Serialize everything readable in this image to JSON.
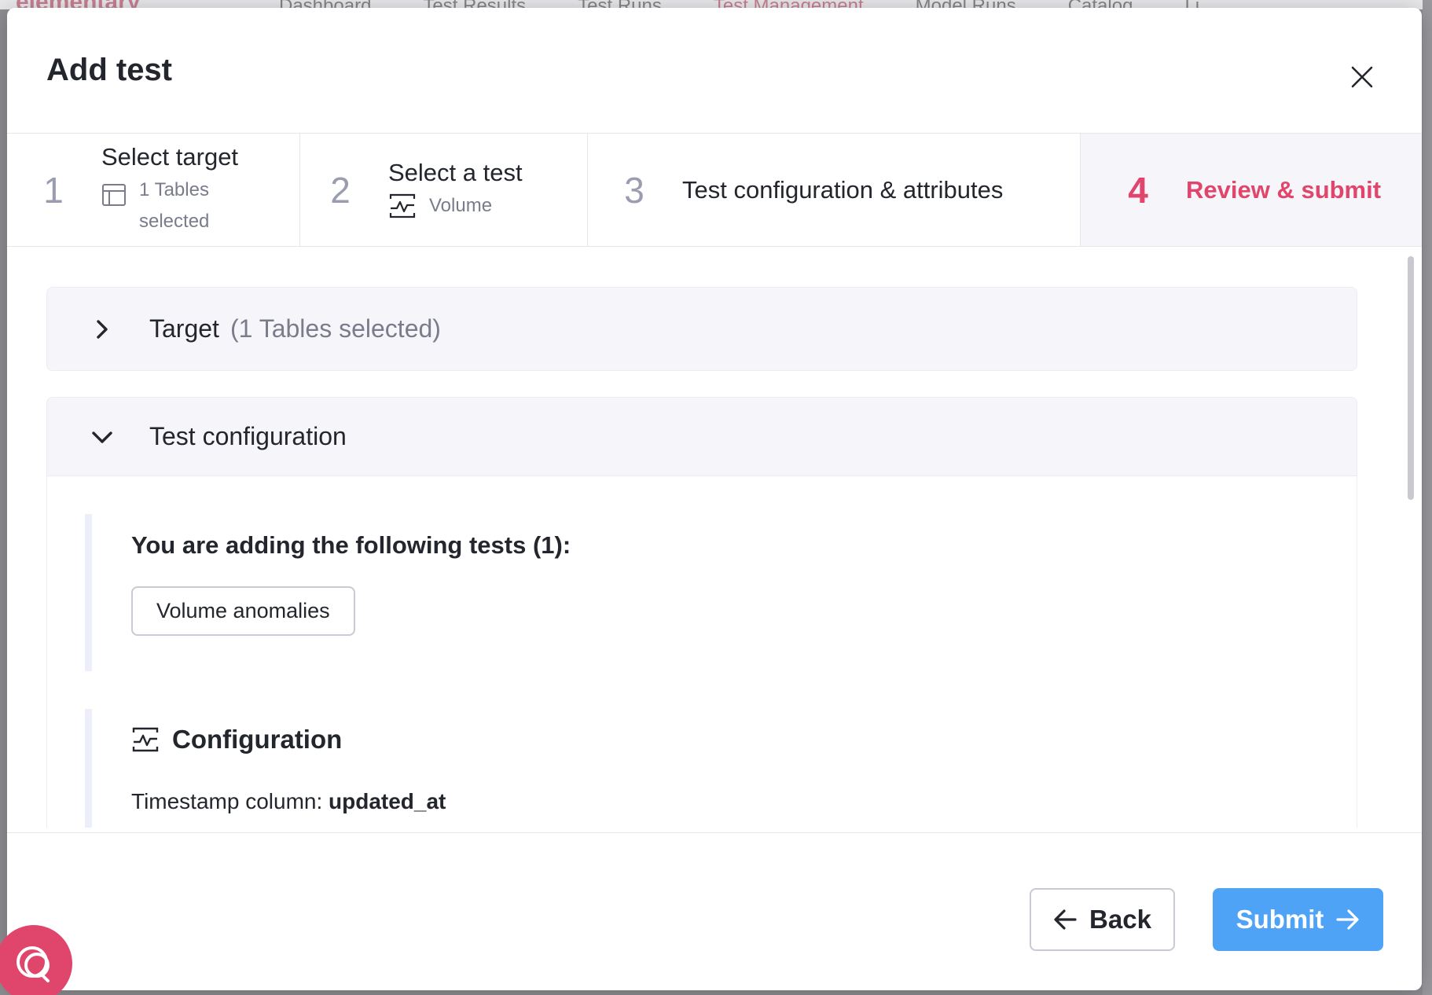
{
  "background": {
    "logo": "elementary",
    "nav_tabs": [
      "Dashboard",
      "Test Results",
      "Test Runs",
      "Test Management",
      "Model Runs",
      "Catalog",
      "Li"
    ],
    "active_tab": "Test Management"
  },
  "modal": {
    "title": "Add test",
    "close_icon": "close-icon"
  },
  "stepper": {
    "steps": [
      {
        "number": "1",
        "label": "Select target",
        "sub": "1 Tables selected",
        "icon": "table-icon"
      },
      {
        "number": "2",
        "label": "Select a test",
        "sub": "Volume",
        "icon": "volume-chart-icon"
      },
      {
        "number": "3",
        "label": "Test configuration & attributes"
      },
      {
        "number": "4",
        "label": "Review & submit",
        "active": true
      }
    ]
  },
  "sections": {
    "target": {
      "title": "Target",
      "count": "(1 Tables selected)",
      "expanded": false
    },
    "test_configuration": {
      "title": "Test configuration",
      "expanded": true,
      "adding_title": "You are adding the following tests (1):",
      "tests": [
        "Volume anomalies"
      ],
      "configuration_title": "Configuration",
      "timestamp_label": "Timestamp column:",
      "timestamp_value": "updated_at"
    }
  },
  "footer": {
    "back_label": "Back",
    "submit_label": "Submit"
  },
  "colors": {
    "accent": "#e0466c",
    "primary_button": "#4fa3f7",
    "muted_text": "#7a7c8c"
  }
}
